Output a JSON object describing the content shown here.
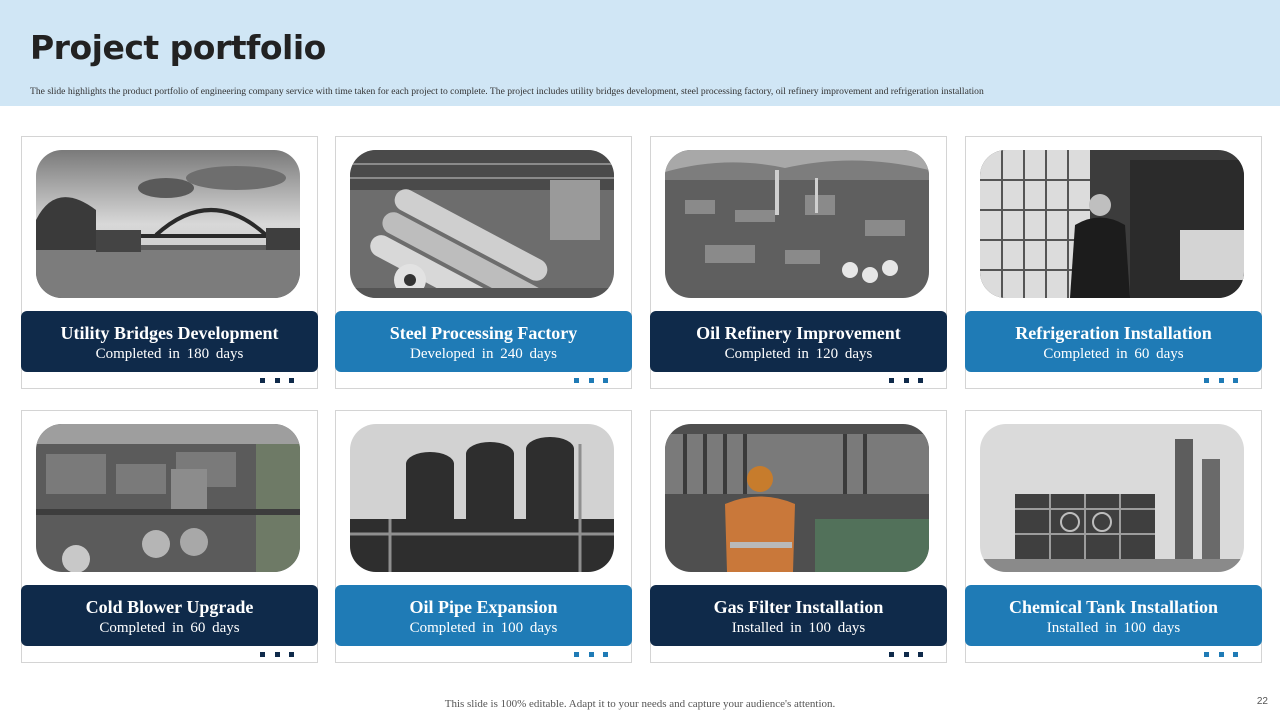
{
  "header": {
    "title": "Project portfolio",
    "subtitle": "The slide highlights the product portfolio of engineering company service with time taken for each project to complete. The project includes utility bridges development, steel processing factory, oil refinery improvement and refrigeration installation"
  },
  "cards": [
    {
      "title": "Utility Bridges Development",
      "subtitle": "Completed  in  180 days",
      "theme": "dark",
      "image": "bridge-photo"
    },
    {
      "title": "Steel Processing Factory",
      "subtitle": "Developed  in  240 days",
      "theme": "light",
      "image": "steel-factory-photo"
    },
    {
      "title": "Oil Refinery Improvement",
      "subtitle": "Completed  in  120 days",
      "theme": "dark",
      "image": "oil-refinery-photo"
    },
    {
      "title": "Refrigeration Installation",
      "subtitle": "Completed  in  60 days",
      "theme": "light",
      "image": "refrigeration-photo"
    },
    {
      "title": "Cold Blower Upgrade",
      "subtitle": "Completed  in  60 days",
      "theme": "dark",
      "image": "cold-blower-photo"
    },
    {
      "title": "Oil Pipe Expansion",
      "subtitle": "Completed  in  100 days",
      "theme": "light",
      "image": "oil-pipe-photo"
    },
    {
      "title": "Gas Filter Installation",
      "subtitle": "Installed  in  100 days",
      "theme": "dark",
      "image": "gas-filter-photo"
    },
    {
      "title": "Chemical Tank Installation",
      "subtitle": "Installed  in  100 days",
      "theme": "light",
      "image": "chemical-tank-photo"
    }
  ],
  "footer": {
    "note": "This slide is 100% editable.  Adapt it to your needs and capture your audience's  attention.",
    "page_number": "22"
  },
  "colors": {
    "header_bg": "#d0e6f5",
    "dark_band": "#0f2a4a",
    "light_band": "#1f7bb6"
  }
}
